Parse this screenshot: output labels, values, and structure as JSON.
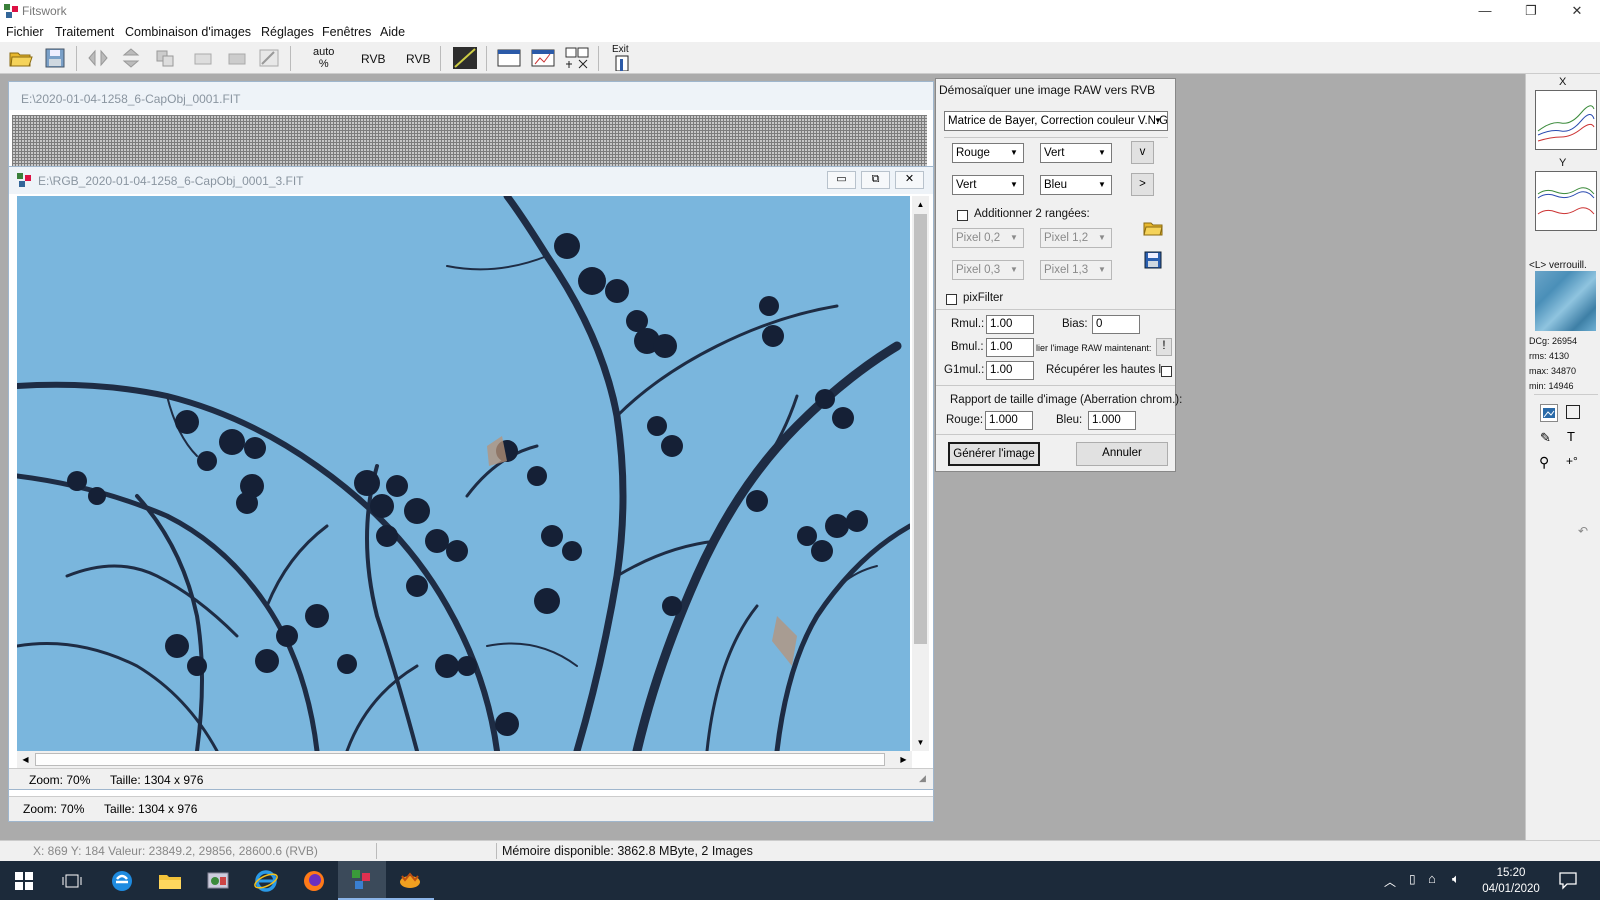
{
  "window": {
    "title": "Fitswork",
    "minimize": "—",
    "maximize": "❐",
    "close": "✕"
  },
  "menu": [
    "Fichier",
    "Traitement",
    "Combinaison d'images",
    "Réglages",
    "Fenêtres",
    "Aide"
  ],
  "toolbar": {
    "auto_line1": "auto",
    "auto_line2": "%",
    "rvb1": "RVB",
    "rvb2": "RVB",
    "exit": "Exit"
  },
  "child_back": {
    "title": "E:\\2020-01-04-1258_6-CapObj_0001.FIT",
    "zoom": "Zoom: 70%",
    "size": "Taille: 1304 x 976"
  },
  "child_front": {
    "title": "E:\\RGB_2020-01-04-1258_6-CapObj_0001_3.FIT",
    "zoom": "Zoom: 70%",
    "size": "Taille: 1304 x 976"
  },
  "dialog": {
    "title": "Démosaïquer une image RAW vers RVB",
    "mode": "Matrice de Bayer, Correction couleur V.N.G",
    "matrix": [
      "Rouge",
      "Vert",
      "Vert",
      "Bleu"
    ],
    "btn_v": "v",
    "btn_gt": ">",
    "add_rows_label": "Additionner 2 rangées:",
    "pixels": [
      "Pixel 0,2",
      "Pixel 1,2",
      "Pixel 0,3",
      "Pixel 1,3"
    ],
    "pixfilter_label": "pixFilter",
    "rmul_label": "Rmul.:",
    "rmul": "1.00",
    "bias_label": "Bias:",
    "bias": "0",
    "bmul_label": "Bmul.:",
    "bmul": "1.00",
    "link_label": "lier l'image RAW maintenant:",
    "link_btn": "!",
    "g1mul_label": "G1mul.:",
    "g1mul": "1.00",
    "recover_label": "Récupérer les hautes lu",
    "ratio_label": "Rapport de taille d'image (Aberration chrom.):",
    "rouge_label": "Rouge:",
    "rouge": "1.000",
    "bleu_label": "Bleu:",
    "bleu": "1.000",
    "generate": "Générer l'image",
    "cancel": "Annuler"
  },
  "right_panel": {
    "x_label": "X",
    "y_label": "Y",
    "lock_label": "<L> verrouill.",
    "stats": [
      "DCg: 26954",
      "rms: 4130",
      "max: 34870",
      "min: 14946"
    ]
  },
  "status": {
    "coords": "X: 869  Y: 184  Valeur: 23849.2, 29856, 28600.6 (RVB)",
    "memory": "Mémoire disponible: 3862.8 MByte, 2 Images"
  },
  "clock": {
    "time": "15:20",
    "date": "04/01/2020"
  },
  "colors": {
    "sky": "#7ab6dd",
    "branch": "#1e2c44",
    "taskbar": "#1c2a3a"
  }
}
